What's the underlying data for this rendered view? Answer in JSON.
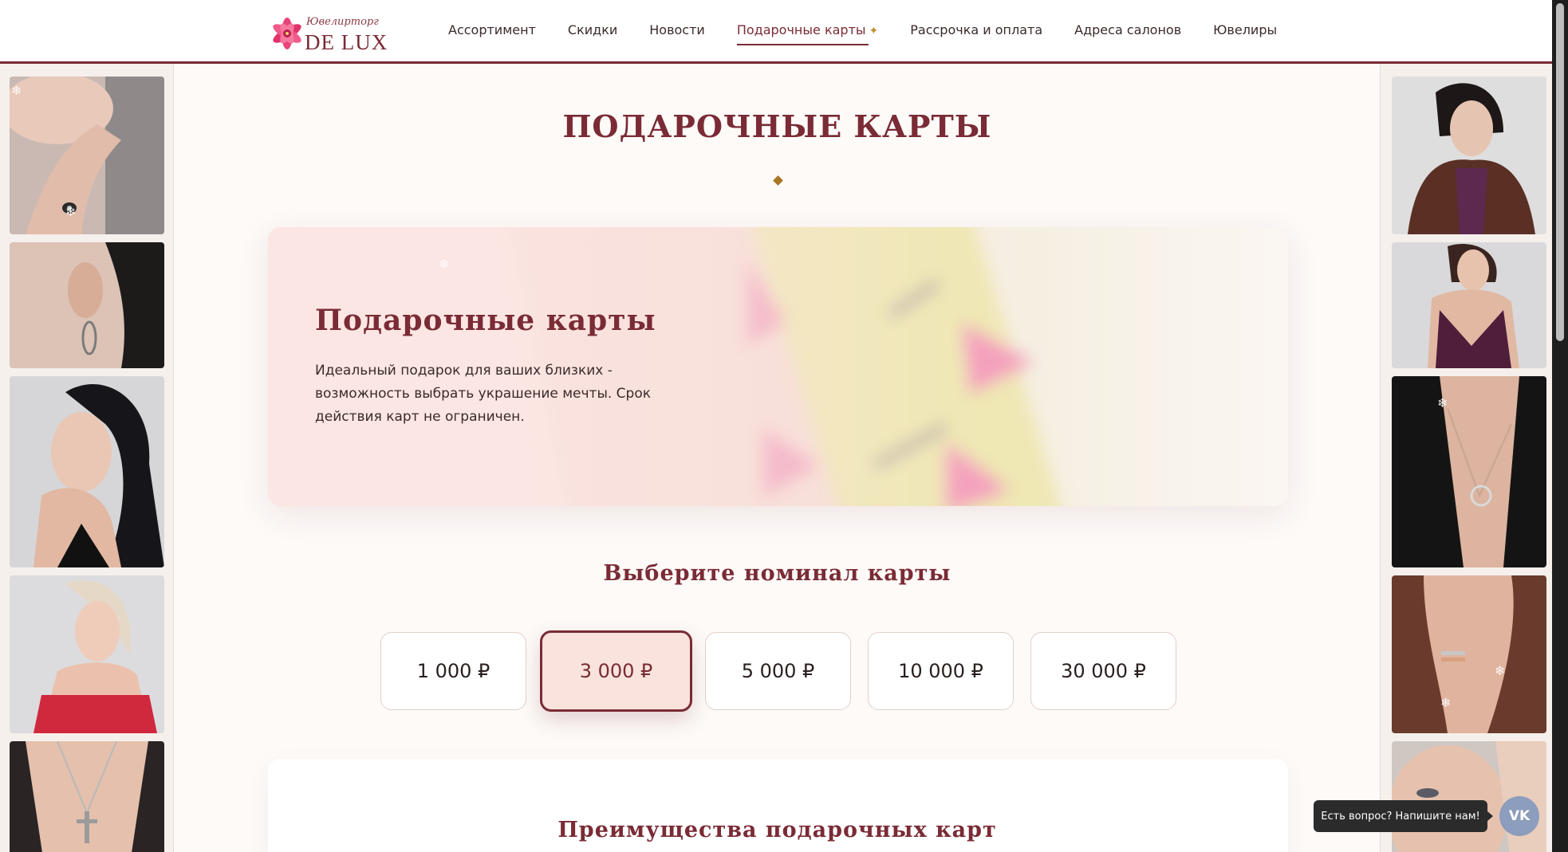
{
  "brand": {
    "script_text": "Ювелирторг",
    "name": "DE LUX"
  },
  "nav": {
    "items": [
      {
        "label": "Ассортимент"
      },
      {
        "label": "Скидки"
      },
      {
        "label": "Новости"
      },
      {
        "label": "Подарочные карты"
      },
      {
        "label": "Рассрочка и оплата"
      },
      {
        "label": "Адреса салонов"
      },
      {
        "label": "Ювелиры"
      }
    ],
    "active_index": 3
  },
  "page": {
    "title": "ПОДАРОЧНЫЕ КАРТЫ"
  },
  "hero": {
    "title": "Подарочные карты",
    "text": "Идеальный подарок для ваших близких - возможность выбрать украшение мечты. Срок действия карт не ограничен."
  },
  "amounts": {
    "title": "Выберите номинал карты",
    "options": [
      "1 000 ₽",
      "3 000 ₽",
      "5 000 ₽",
      "10 000 ₽",
      "30 000 ₽"
    ],
    "selected_index": 1
  },
  "benefits": {
    "title": "Преимущества подарочных карт"
  },
  "chat": {
    "tooltip": "Есть вопрос? Напишите нам!",
    "vk_label": "VK"
  },
  "colors": {
    "accent": "#7a2b35",
    "gold": "#a77523",
    "background": "#fdfaf8",
    "selected_bg": "#f9e3dc"
  },
  "icons": {
    "logo": "lily-flower-icon",
    "nav_star": "sparkle-icon",
    "chat": "vk-icon"
  }
}
